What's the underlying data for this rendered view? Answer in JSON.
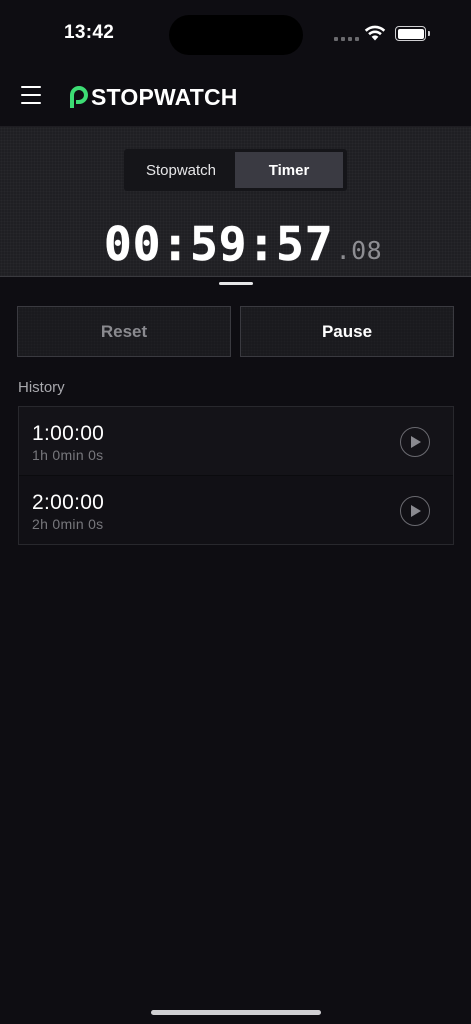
{
  "status_bar": {
    "time": "13:42"
  },
  "header": {
    "brand": "STOPWATCH",
    "menu_icon": "hamburger-icon",
    "logo_icon": "logo-p-icon",
    "logo_color": "#3ddc74"
  },
  "mode_tabs": [
    {
      "label": "Stopwatch",
      "selected": false
    },
    {
      "label": "Timer",
      "selected": true
    }
  ],
  "timer": {
    "main": "00:59:57",
    "fraction": ".08"
  },
  "controls": {
    "reset_label": "Reset",
    "pause_label": "Pause"
  },
  "history": {
    "title": "History",
    "items": [
      {
        "time": "1:00:00",
        "duration": "1h 0min 0s",
        "action_icon": "play-icon"
      },
      {
        "time": "2:00:00",
        "duration": "2h 0min 0s",
        "action_icon": "play-icon"
      }
    ]
  }
}
